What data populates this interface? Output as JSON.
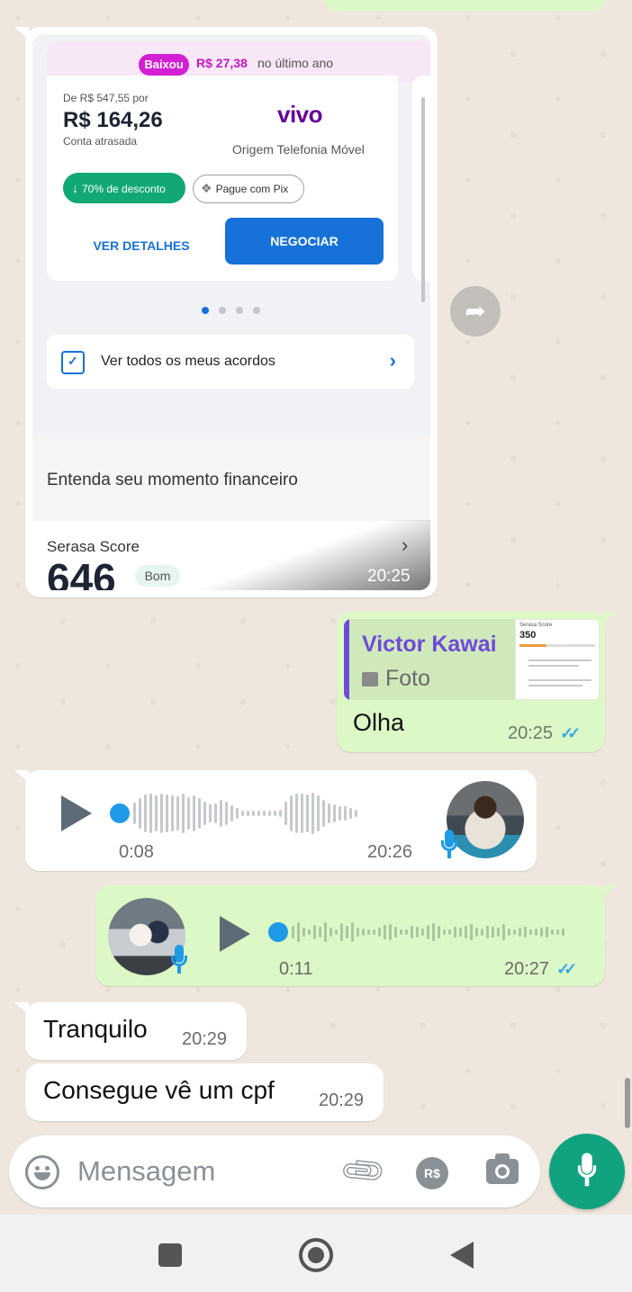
{
  "image_message": {
    "price_banner": {
      "badge": "Baixou",
      "amount": "R$ 27,38",
      "suffix": "no último ano"
    },
    "offer": {
      "from_price": "De R$ 547,55 por",
      "price": "R$ 164,26",
      "status": "Conta atrasada",
      "brand": "vivo",
      "origin": "Origem Telefonia Móvel",
      "discount_chip": "70% de desconto",
      "pix_chip": "Pague com Pix",
      "details_button": "VER DETALHES",
      "negotiate_button": "NEGOCIAR"
    },
    "carousel": {
      "page_count": 4,
      "active_index": 0
    },
    "agreements_link": "Ver todos os meus acordos",
    "section_title": "Entenda seu momento financeiro",
    "score": {
      "title": "Serasa Score",
      "value": "646",
      "rating": "Bom"
    },
    "time": "20:25"
  },
  "reply_message": {
    "quote_author": "Victor Kawai",
    "quote_type": "Foto",
    "quote_thumb": {
      "label": "Serasa Score",
      "score": "350"
    },
    "text": "Olha",
    "time": "20:25",
    "status": "read"
  },
  "voice_in": {
    "duration": "0:08",
    "time": "20:26",
    "progress": 0.0
  },
  "voice_out": {
    "duration": "0:11",
    "time": "20:27",
    "progress": 0.0,
    "status": "read"
  },
  "text_messages": [
    {
      "text": "Tranquilo",
      "time": "20:29"
    },
    {
      "text": "Consegue vê um cpf",
      "time": "20:29"
    }
  ],
  "composer": {
    "placeholder": "Mensagem",
    "pay_label": "R$"
  },
  "colors": {
    "chat_background": "#efe7de",
    "outgoing_bubble": "#dcf8c6",
    "incoming_bubble": "#ffffff",
    "accent_green": "#11a37f",
    "read_ticks": "#3aa6e8",
    "quote_accent": "#6f4bd8",
    "serasa_blue": "#1672d8",
    "serasa_pink": "#d31fd4",
    "vivo_purple": "#660099"
  },
  "icons": {
    "forward": "forward-icon",
    "play": "play-icon",
    "mic": "mic-icon",
    "emoji": "emoji-icon",
    "attach": "paperclip-icon",
    "payment": "payment-icon",
    "camera": "camera-icon",
    "nav_recents": "recents-icon",
    "nav_home": "home-icon",
    "nav_back": "back-icon"
  }
}
